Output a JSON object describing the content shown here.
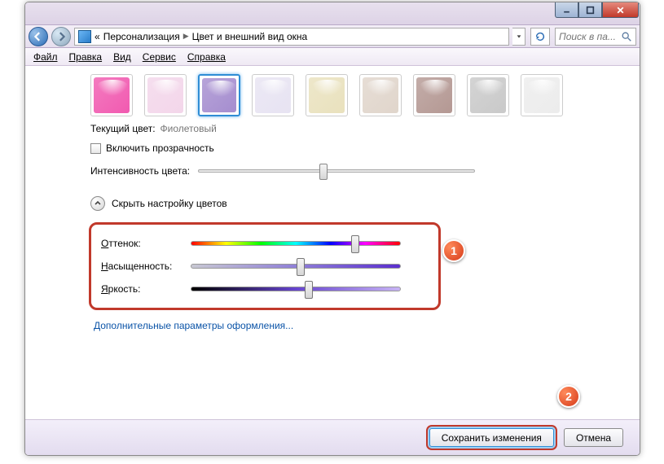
{
  "breadcrumb": {
    "root": "Персонализация",
    "page": "Цвет и внешний вид окна"
  },
  "search": {
    "placeholder": "Поиск в па..."
  },
  "menu": {
    "file": "Файл",
    "edit": "Правка",
    "view": "Вид",
    "tools": "Сервис",
    "help": "Справка"
  },
  "swatches": [
    {
      "color": "#f15ab0"
    },
    {
      "color": "#f3d6ea"
    },
    {
      "color": "#a58dcf",
      "selected": true
    },
    {
      "color": "#e7e3f2"
    },
    {
      "color": "#e9e1bd"
    },
    {
      "color": "#e0d5cb"
    },
    {
      "color": "#b49893"
    },
    {
      "color": "#c9c9c9"
    },
    {
      "color": "#ececec"
    }
  ],
  "current_label": "Текущий цвет:",
  "current_value": "Фиолетовый",
  "transparency": "Включить прозрачность",
  "intensity_label": "Интенсивность цвета:",
  "intensity_pos": 0.45,
  "toggle_label": "Скрыть настройку цветов",
  "mixer": {
    "hue": {
      "label": "Оттенок:",
      "pos": 0.78
    },
    "sat": {
      "label": "Насыщенность:",
      "pos": 0.52
    },
    "bri": {
      "label": "Яркость:",
      "pos": 0.56
    }
  },
  "advanced_link": "Дополнительные параметры оформления...",
  "buttons": {
    "save": "Сохранить изменения",
    "cancel": "Отмена"
  },
  "badges": {
    "one": "1",
    "two": "2"
  }
}
